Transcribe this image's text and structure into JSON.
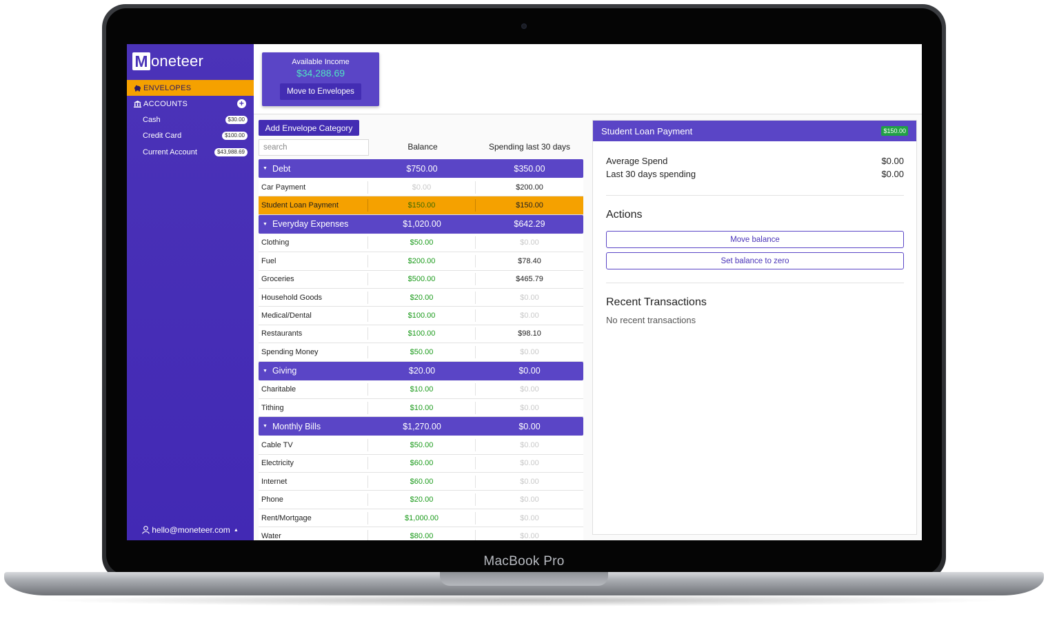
{
  "device": {
    "brand_label": "MacBook Pro"
  },
  "app": {
    "logo_letter": "M",
    "logo_text": "oneteer"
  },
  "sidebar": {
    "envelopes_label": "ENVELOPES",
    "accounts_label": "ACCOUNTS",
    "accounts": [
      {
        "name": "Cash",
        "balance": "$30.00"
      },
      {
        "name": "Credit Card",
        "balance": "$100.00"
      },
      {
        "name": "Current Account",
        "balance": "$43,988.69"
      }
    ],
    "user_email": "hello@moneteer.com"
  },
  "income": {
    "label": "Available Income",
    "value": "$34,288.69",
    "button_label": "Move to Envelopes"
  },
  "envelopes": {
    "add_category_label": "Add Envelope Category",
    "search_placeholder": "search",
    "columns": {
      "balance": "Balance",
      "spending": "Spending last 30 days"
    },
    "categories": [
      {
        "name": "Debt",
        "balance": "$750.00",
        "spending": "$350.00",
        "items": [
          {
            "name": "Car Payment",
            "balance": "$0.00",
            "spending": "$200.00",
            "balance_tone": "gray",
            "spending_tone": "dark"
          },
          {
            "name": "Student Loan Payment",
            "balance": "$150.00",
            "spending": "$150.00",
            "balance_tone": "green",
            "spending_tone": "dark",
            "selected": true
          }
        ]
      },
      {
        "name": "Everyday Expenses",
        "balance": "$1,020.00",
        "spending": "$642.29",
        "items": [
          {
            "name": "Clothing",
            "balance": "$50.00",
            "spending": "$0.00",
            "balance_tone": "green",
            "spending_tone": "gray"
          },
          {
            "name": "Fuel",
            "balance": "$200.00",
            "spending": "$78.40",
            "balance_tone": "green",
            "spending_tone": "dark"
          },
          {
            "name": "Groceries",
            "balance": "$500.00",
            "spending": "$465.79",
            "balance_tone": "green",
            "spending_tone": "dark"
          },
          {
            "name": "Household Goods",
            "balance": "$20.00",
            "spending": "$0.00",
            "balance_tone": "green",
            "spending_tone": "gray"
          },
          {
            "name": "Medical/Dental",
            "balance": "$100.00",
            "spending": "$0.00",
            "balance_tone": "green",
            "spending_tone": "gray"
          },
          {
            "name": "Restaurants",
            "balance": "$100.00",
            "spending": "$98.10",
            "balance_tone": "green",
            "spending_tone": "dark"
          },
          {
            "name": "Spending Money",
            "balance": "$50.00",
            "spending": "$0.00",
            "balance_tone": "green",
            "spending_tone": "gray"
          }
        ]
      },
      {
        "name": "Giving",
        "balance": "$20.00",
        "spending": "$0.00",
        "items": [
          {
            "name": "Charitable",
            "balance": "$10.00",
            "spending": "$0.00",
            "balance_tone": "green",
            "spending_tone": "gray"
          },
          {
            "name": "Tithing",
            "balance": "$10.00",
            "spending": "$0.00",
            "balance_tone": "green",
            "spending_tone": "gray"
          }
        ]
      },
      {
        "name": "Monthly Bills",
        "balance": "$1,270.00",
        "spending": "$0.00",
        "items": [
          {
            "name": "Cable TV",
            "balance": "$50.00",
            "spending": "$0.00",
            "balance_tone": "green",
            "spending_tone": "gray"
          },
          {
            "name": "Electricity",
            "balance": "$60.00",
            "spending": "$0.00",
            "balance_tone": "green",
            "spending_tone": "gray"
          },
          {
            "name": "Internet",
            "balance": "$60.00",
            "spending": "$0.00",
            "balance_tone": "green",
            "spending_tone": "gray"
          },
          {
            "name": "Phone",
            "balance": "$20.00",
            "spending": "$0.00",
            "balance_tone": "green",
            "spending_tone": "gray"
          },
          {
            "name": "Rent/Mortgage",
            "balance": "$1,000.00",
            "spending": "$0.00",
            "balance_tone": "green",
            "spending_tone": "gray"
          },
          {
            "name": "Water",
            "balance": "$80.00",
            "spending": "$0.00",
            "balance_tone": "green",
            "spending_tone": "gray"
          }
        ]
      }
    ]
  },
  "detail": {
    "title": "Student Loan Payment",
    "badge": "$150.00",
    "average_spend_label": "Average Spend",
    "average_spend_value": "$0.00",
    "last30_label": "Last 30 days spending",
    "last30_value": "$0.00",
    "actions_title": "Actions",
    "move_balance_label": "Move balance",
    "set_zero_label": "Set balance to zero",
    "recent_title": "Recent Transactions",
    "recent_empty": "No recent transactions"
  },
  "colors": {
    "primary": "#5a45c6",
    "sidebar": "#4229b4",
    "selected": "#f5a100",
    "positive": "#1a9a1a",
    "income_value": "#51e5c3"
  }
}
